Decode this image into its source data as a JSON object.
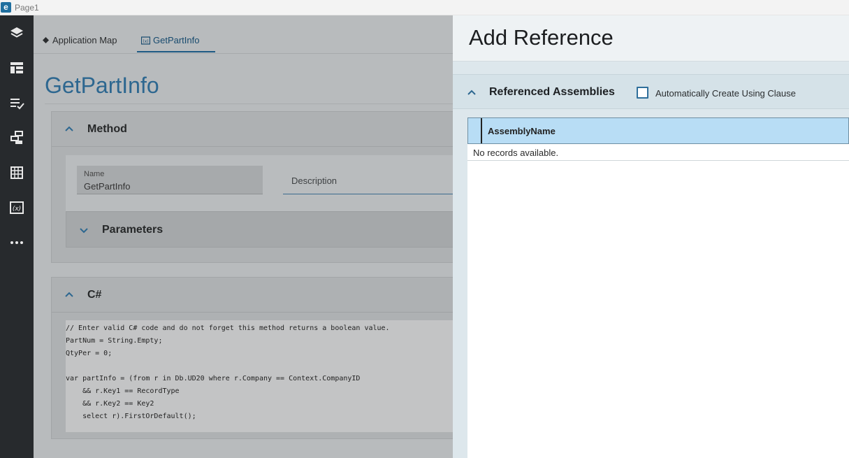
{
  "window": {
    "title": "Page1",
    "logo": "e"
  },
  "rail": {
    "icons": [
      "layers-icon",
      "layout-icon",
      "checklist-icon",
      "data-flow-icon",
      "grid-table-icon",
      "function-icon",
      "more-icon"
    ]
  },
  "tabs": [
    {
      "label": "Application Map",
      "icon": "diamond-icon"
    },
    {
      "label": "GetPartInfo",
      "icon": "function-icon"
    }
  ],
  "page": {
    "title": "GetPartInfo"
  },
  "method_section": {
    "title": "Method",
    "name_label": "Name",
    "name_value": "GetPartInfo",
    "description_label": "Description",
    "parameters_title": "Parameters"
  },
  "code_section": {
    "title": "C#",
    "lines": [
      "// Enter valid C# code and do not forget this method returns a boolean value.",
      "PartNum = String.Empty;",
      "QtyPer = 0;",
      "",
      "var partInfo = (from r in Db.UD20 where r.Company == Context.CompanyID",
      "    && r.Key1 == RecordType",
      "    && r.Key2 == Key2",
      "    select r).FirstOrDefault();"
    ]
  },
  "add_reference": {
    "title": "Add Reference",
    "section_title": "Referenced Assemblies",
    "checkbox_label": "Automatically Create Using Clause",
    "checkbox_checked": false,
    "grid": {
      "columns": [
        "AssemblyName"
      ],
      "empty_text": "No records available."
    }
  },
  "colors": {
    "accent": "#2d6790",
    "rail": "#272a2d",
    "grid_header": "#b8ddf5"
  }
}
